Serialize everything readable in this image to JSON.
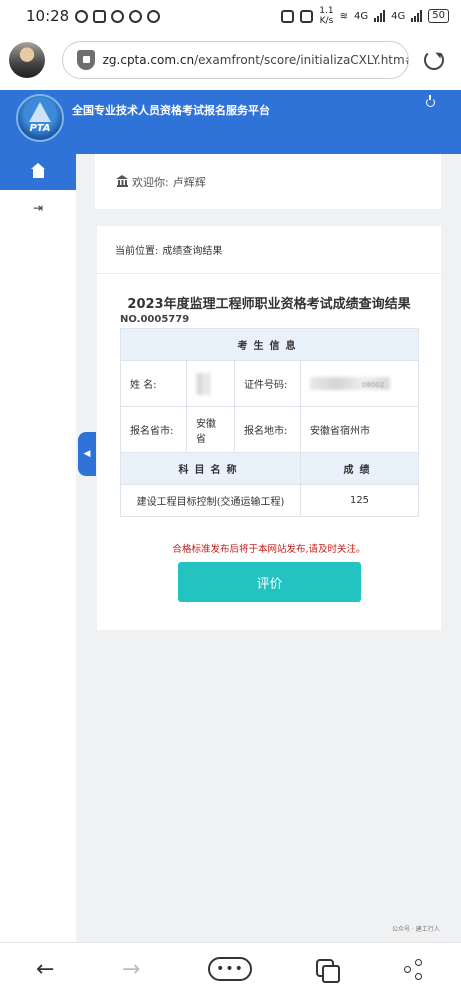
{
  "status_bar": {
    "time": "10:28",
    "net_speed_value": "1.1",
    "net_speed_unit": "K/s",
    "network_label_1": "4G",
    "network_label_2": "4G",
    "battery": "50"
  },
  "browser": {
    "url_host": "zg.cpta.com.cn",
    "url_path": "/examfront/score/initializaCXLY.htm#"
  },
  "site": {
    "logo_text": "PTA",
    "title": "全国专业技术人员资格考试报名服务平台"
  },
  "welcome": {
    "prefix": "欢迎你:",
    "name": "卢辉辉"
  },
  "breadcrumb": {
    "label": "当前位置:",
    "page": "成绩查询结果"
  },
  "result": {
    "title": "2023年度监理工程师职业资格考试成绩查询结果",
    "number": "NO.0005779",
    "candidate_header": "考生信息",
    "name_label": "姓    名:",
    "id_label": "证件号码:",
    "id_visible_fragment": "08002",
    "province_label": "报名省市:",
    "province_value": "安徽省",
    "location_label": "报名地市:",
    "location_value": "安徽省宿州市",
    "subject_header": "科目名称",
    "score_header": "成绩",
    "scores": [
      {
        "subject": "建设工程目标控制(交通运输工程)",
        "score": "125"
      }
    ],
    "notice": "合格标准发布后将于本网站发布,请及时关注。",
    "rate_button": "评价"
  },
  "watermark": "公众号 · 建工行人"
}
